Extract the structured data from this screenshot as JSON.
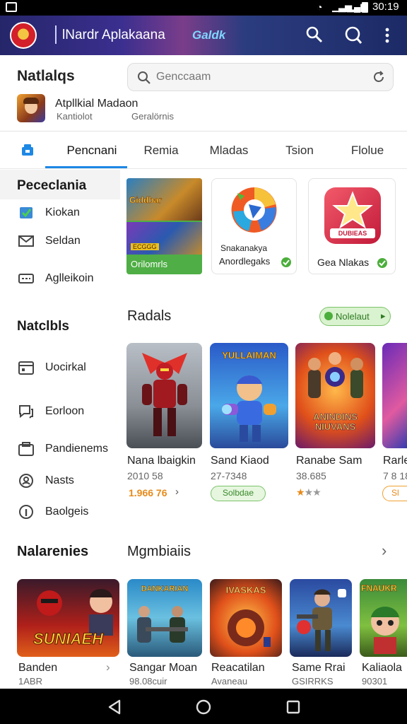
{
  "status": {
    "time": "30:19"
  },
  "appbar": {
    "title": "lNardr Aplakaana",
    "banner_text": "Galdk"
  },
  "header": {
    "section_title": "Natlalqs",
    "search_placeholder": "Genccaam"
  },
  "featured_app": {
    "name": "Atpllkial Madaon",
    "sub1": "Kantiolot",
    "sub2": "Geralörnis"
  },
  "tabs": [
    "Pencnani",
    "Remia",
    "Mladas",
    "Tsion",
    "Flolue"
  ],
  "sidebar": {
    "section1": "Pececlania",
    "items1": [
      "Kiokan",
      "Seldan",
      "Aglleikoin"
    ],
    "section2": "Natclbls",
    "items2": [
      "Uocirkal",
      "Eorloon",
      "Pandienems",
      "Nasts",
      "Baolgeis"
    ],
    "section3": "Nalarenies"
  },
  "promo": {
    "tile1_label": "Orilomrls",
    "tile1_banner": "Giddbar",
    "tile1_sub": "ECGGG",
    "tile2_text1": "Snakanakya",
    "tile2_text2": "Anordlegaks",
    "tile3_text": "Gea Nlakas",
    "tile3_badge": "DUBIEAS"
  },
  "section_radals": {
    "title": "Radals",
    "button": "Nolelaut",
    "games": [
      {
        "name": "Nana lbaigkin",
        "code": "2010 58",
        "meta": "1.966 76",
        "meta_type": "orange"
      },
      {
        "name": "Sand Kiaod",
        "code": "27-7348",
        "meta": "Solbdae",
        "meta_type": "pill"
      },
      {
        "name": "Ranabe Sam",
        "code": "38.685",
        "meta": "",
        "meta_type": "stars"
      },
      {
        "name": "Rarle",
        "code": "7 8 18",
        "meta": "Sl",
        "meta_type": "orange-pill"
      }
    ],
    "art_text": [
      "",
      "YULLAIMAN",
      "ANINDINS NIUVANS",
      ""
    ]
  },
  "section_mg": {
    "title": "Mgmbiaiis",
    "games": [
      {
        "name": "Banden",
        "code": "1ABR",
        "art": "SUNIAEH"
      },
      {
        "name": "Sangar Moan",
        "code": "98.08cuir",
        "art": "DANKARIAN"
      },
      {
        "name": "Reacatilan",
        "code": "Avaneau",
        "art": "IVASKAS"
      },
      {
        "name": "Same Rrai",
        "code": "GSIRRKS",
        "art": ""
      },
      {
        "name": "Kaliaola",
        "code": "90301",
        "art": "FNAUKR"
      }
    ]
  },
  "colors": {
    "appbar": "#2b2f7a",
    "accent": "#1e88e5",
    "green": "#5cb84a",
    "orange": "#e88a1a"
  }
}
